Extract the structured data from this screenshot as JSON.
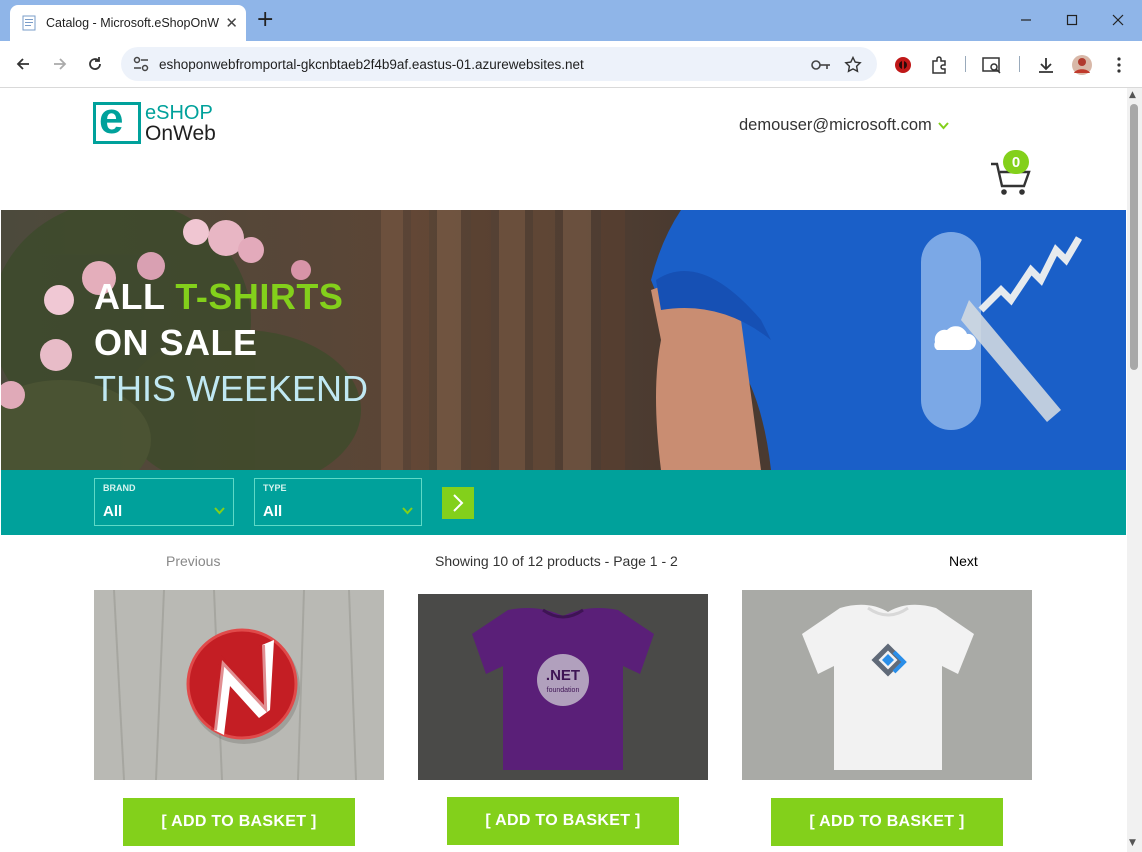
{
  "browser": {
    "tab_title": "Catalog - Microsoft.eShopOnW",
    "url": "eshoponwebfromportal-gkcnbtaeb2f4b9af.eastus-01.azurewebsites.net",
    "colors": {
      "titlebar": "#8fb5e8",
      "omnibox": "#edf2fa"
    }
  },
  "header": {
    "logo_line1": "eSHOP",
    "logo_line2": "OnWeb",
    "logo_letter": "e",
    "user": "demouser@microsoft.com",
    "cart_count": "0"
  },
  "hero": {
    "line1_a": "ALL ",
    "line1_b": "T-SHIRTS",
    "line2": "ON SALE",
    "line3": "THIS WEEKEND"
  },
  "filters": {
    "brand_label": "BRAND",
    "brand_value": "All",
    "type_label": "TYPE",
    "type_value": "All"
  },
  "pager": {
    "previous": "Previous",
    "status": "Showing 10 of 12 products - Page 1 - 2",
    "next": "Next"
  },
  "products": [
    {
      "button": "[ ADD TO BASKET ]",
      "image": "red-pin"
    },
    {
      "button": "[ ADD TO BASKET ]",
      "image": "purple-dotnet-tshirt",
      "shirt_text": ".NET",
      "shirt_subtext": "foundation"
    },
    {
      "button": "[ ADD TO BASKET ]",
      "image": "white-logo-tshirt"
    }
  ],
  "theme": {
    "teal": "#00a19b",
    "green": "#83d01b"
  }
}
